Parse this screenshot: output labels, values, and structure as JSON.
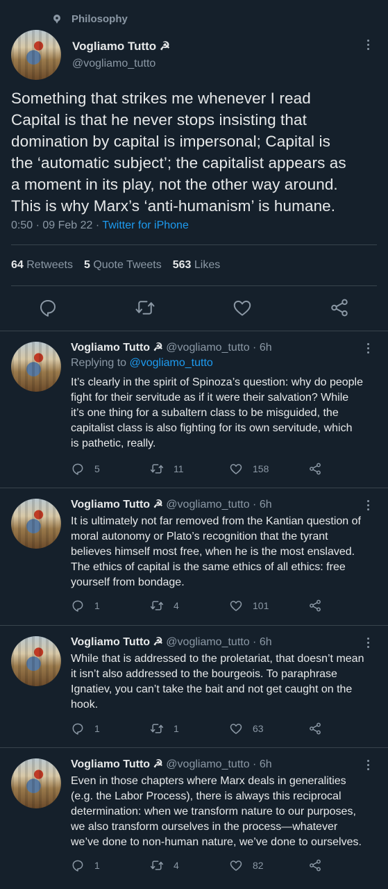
{
  "topic": {
    "label": "Philosophy",
    "icon": "topic-pin-icon"
  },
  "main_tweet": {
    "name": "Vogliamo Tutto ☭",
    "handle": "@vogliamo_tutto",
    "lines": [
      "Something that strikes me whenever I read",
      "Capital is that he never stops insisting that",
      "domination by capital is impersonal; Capital is",
      "the ‘automatic subject’; the capitalist appears as",
      "a moment in its play, not the other way around.",
      "This is why Marx’s ‘anti-humanism’ is humane."
    ],
    "timestamp": "0:50 · 09 Feb 22 · ",
    "source": "Twitter for iPhone",
    "stats": {
      "retweets_count": "64",
      "retweets_label": "Retweets",
      "quotes_count": "5",
      "quotes_label": "Quote Tweets",
      "likes_count": "563",
      "likes_label": "Likes"
    }
  },
  "replies": [
    {
      "name": "Vogliamo Tutto ☭",
      "meta": "@vogliamo_tutto · 6h",
      "replying_label": "Replying to ",
      "replying_to": "@vogliamo_tutto",
      "lines": [
        "It’s clearly in the spirit of Spinoza’s question: why do people",
        "fight for their servitude as if it were their salvation? While",
        "it’s one thing for a subaltern class to be misguided, the",
        "capitalist class is also fighting for its own servitude, which",
        "is pathetic, really."
      ],
      "replies": "5",
      "retweets": "11",
      "likes": "158"
    },
    {
      "name": "Vogliamo Tutto ☭",
      "meta": "@vogliamo_tutto · 6h",
      "lines": [
        "It is ultimately not far removed from the Kantian question of",
        "moral autonomy or Plato’s recognition that the tyrant",
        "believes himself most free, when he is the most enslaved.",
        "The ethics of capital is the same ethics of all ethics: free",
        "yourself from bondage."
      ],
      "replies": "1",
      "retweets": "4",
      "likes": "101"
    },
    {
      "name": "Vogliamo Tutto ☭",
      "meta": "@vogliamo_tutto · 6h",
      "lines": [
        "While that is addressed to the proletariat, that doesn’t mean",
        "it isn’t also addressed to the bourgeois. To paraphrase",
        "Ignatiev, you can’t take the bait and not get caught on the",
        "hook."
      ],
      "replies": "1",
      "retweets": "1",
      "likes": "63"
    },
    {
      "name": "Vogliamo Tutto ☭",
      "meta": "@vogliamo_tutto · 6h",
      "lines": [
        "Even in those chapters where Marx deals in generalities",
        "(e.g. the Labor Process), there is always this reciprocal",
        "determination: when we transform nature to our purposes,",
        "we also transform ourselves in the process—whatever",
        "we’ve done to non-human nature, we’ve done to ourselves."
      ],
      "replies": "1",
      "retweets": "4",
      "likes": "82"
    }
  ],
  "colors": {
    "background": "#15202b",
    "text": "#e7e9ea",
    "muted": "#8b98a5",
    "accent": "#1d9bf0",
    "divider": "#38444d"
  }
}
